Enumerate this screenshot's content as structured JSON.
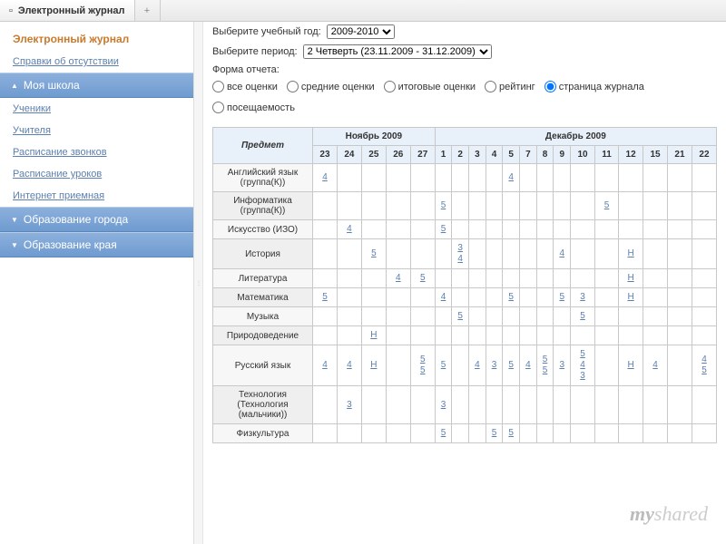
{
  "tab": {
    "title": "Электронный журнал",
    "add": "+"
  },
  "sidebar": {
    "title": "Электронный журнал",
    "absence": "Справки об отсутствии",
    "school": {
      "label": "Моя школа",
      "items": [
        "Ученики",
        "Учителя",
        "Расписание звонков",
        "Расписание уроков",
        "Интернет приемная"
      ]
    },
    "city": "Образование города",
    "region": "Образование края"
  },
  "filters": {
    "year_label": "Выберите учебный год:",
    "year_value": "2009-2010",
    "period_label": "Выберите период:",
    "period_value": "2 Четверть (23.11.2009 - 31.12.2009)",
    "form_label": "Форма отчета:",
    "opts": [
      "все оценки",
      "средние оценки",
      "итоговые оценки",
      "рейтинг",
      "страница журнала",
      "посещаемость"
    ],
    "selected": 4
  },
  "table": {
    "subject_header": "Предмет",
    "months": [
      {
        "name": "Ноябрь 2009",
        "days": [
          "23",
          "24",
          "25",
          "26",
          "27"
        ]
      },
      {
        "name": "Декабрь 2009",
        "days": [
          "1",
          "2",
          "3",
          "4",
          "5",
          "7",
          "8",
          "9",
          "10",
          "11",
          "12",
          "15",
          "21",
          "22"
        ]
      }
    ],
    "rows": [
      {
        "subject": "Английский язык (группа(К))",
        "cells": {
          "0": "4",
          "9": "4"
        }
      },
      {
        "subject": "Информатика (группа(К))",
        "cells": {
          "5": "5",
          "14": "5"
        }
      },
      {
        "subject": "Искусство (ИЗО)",
        "cells": {
          "1": "4",
          "5": "5"
        }
      },
      {
        "subject": "История",
        "cells": {
          "2": "5",
          "6": "3\n4",
          "12": "4",
          "15": "Н"
        }
      },
      {
        "subject": "Литература",
        "cells": {
          "3": "4",
          "4": "5",
          "15": "Н"
        }
      },
      {
        "subject": "Математика",
        "cells": {
          "0": "5",
          "5": "4",
          "9": "5",
          "12": "5",
          "13": "3",
          "15": "Н"
        }
      },
      {
        "subject": "Музыка",
        "cells": {
          "6": "5",
          "13": "5"
        }
      },
      {
        "subject": "Природоведение",
        "cells": {
          "2": "Н"
        }
      },
      {
        "subject": "Русский язык",
        "cells": {
          "0": "4",
          "1": "4",
          "2": "Н",
          "4": "5\n5",
          "5": "5",
          "7": "4",
          "8": "3",
          "9": "5",
          "10": "4",
          "11": "5\n5",
          "12": "3",
          "13": "5\n4\n3",
          "15": "Н",
          "16": "4",
          "18": "4\n5"
        }
      },
      {
        "subject": "Технология (Технология (мальчики))",
        "cells": {
          "1": "3",
          "5": "3"
        }
      },
      {
        "subject": "Физкультура",
        "cells": {
          "5": "5",
          "8": "5",
          "9": "5"
        }
      }
    ]
  },
  "watermark": "myshared"
}
